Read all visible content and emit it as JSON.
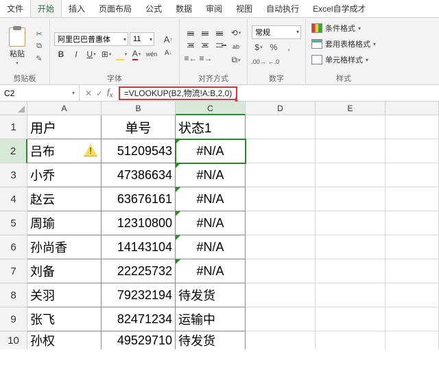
{
  "tabs": [
    "文件",
    "开始",
    "插入",
    "页面布局",
    "公式",
    "数据",
    "审阅",
    "视图",
    "自动执行",
    "Excel自学成才"
  ],
  "active_tab": 1,
  "ribbon": {
    "clipboard": {
      "paste": "粘贴",
      "label": "剪贴板"
    },
    "font": {
      "name": "阿里巴巴普惠体",
      "size": "11",
      "increase": "A",
      "decrease": "A",
      "bold": "B",
      "italic": "I",
      "underline": "U",
      "wen": "wén",
      "label": "字体"
    },
    "align": {
      "wrap": "ab",
      "merge": "合",
      "label": "对齐方式"
    },
    "number": {
      "format": "常规",
      "percent": "%",
      "comma": ",",
      "label": "数字"
    },
    "styles": {
      "cond": "条件格式",
      "table": "套用表格格式",
      "cell": "单元格样式",
      "label": "样式"
    }
  },
  "namebox": "C2",
  "formula": "=VLOOKUP(B2,物流!A:B,2,0)",
  "columns": [
    "A",
    "B",
    "C",
    "D",
    "E"
  ],
  "active_col": 2,
  "active_row": 1,
  "headers": [
    "用户",
    "单号",
    "状态1"
  ],
  "rows": [
    {
      "n": "1",
      "a": "用户",
      "b": "单号",
      "c": "状态1",
      "hdr": true
    },
    {
      "n": "2",
      "a": "吕布",
      "b": "51209543",
      "c": "#N/A",
      "warn": true,
      "err": true,
      "active": true
    },
    {
      "n": "3",
      "a": "小乔",
      "b": "47386634",
      "c": "#N/A",
      "err": true
    },
    {
      "n": "4",
      "a": "赵云",
      "b": "63676161",
      "c": "#N/A",
      "err": true
    },
    {
      "n": "5",
      "a": "周瑜",
      "b": "12310800",
      "c": "#N/A",
      "err": true
    },
    {
      "n": "6",
      "a": "孙尚香",
      "b": "14143104",
      "c": "#N/A",
      "err": true
    },
    {
      "n": "7",
      "a": "刘备",
      "b": "22225732",
      "c": "#N/A",
      "err": true
    },
    {
      "n": "8",
      "a": "关羽",
      "b": "79232194",
      "c": "待发货"
    },
    {
      "n": "9",
      "a": "张飞",
      "b": "82471234",
      "c": "运输中"
    },
    {
      "n": "10",
      "a": "孙权",
      "b": "49529710",
      "c": "待发货"
    }
  ]
}
